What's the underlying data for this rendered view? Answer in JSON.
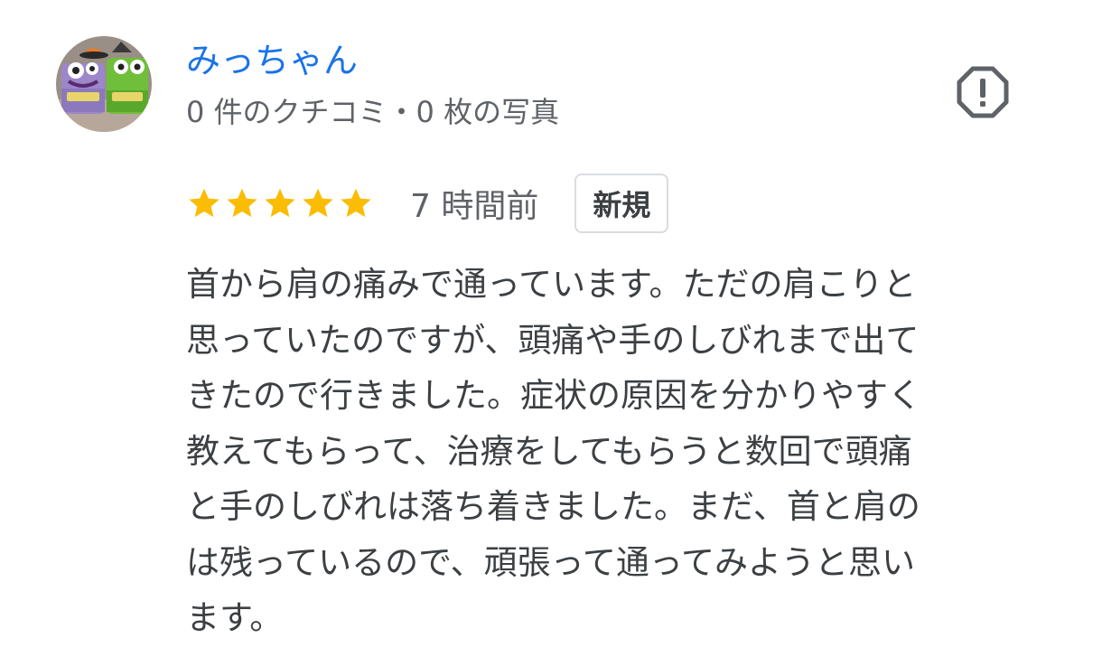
{
  "reviewer": {
    "name": "みっちゃん",
    "stats": "0 件のクチコミ・0 枚の写真",
    "avatar_icon": "monster-cups-avatar"
  },
  "actions": {
    "report_icon": "report-octagon-icon"
  },
  "review": {
    "rating": 5,
    "max_rating": 5,
    "star_color": "#fbbc04",
    "time_ago": "7 時間前",
    "badge": "新規",
    "text": "首から肩の痛みで通っています。ただの肩こりと\n思っていたのですが、頭痛や手のしびれまで出て\nきたので行きました。症状の原因を分かりやすく\n教えてもらって、治療をしてもらうと数回で頭痛\nと手のしびれは落ち着きました。まだ、首と肩の\nは残っているので、頑張って通ってみようと思い\nます。"
  },
  "colors": {
    "name_link": "#1a73e8",
    "secondary_text": "#5f6368",
    "body_text": "#3c4043"
  }
}
